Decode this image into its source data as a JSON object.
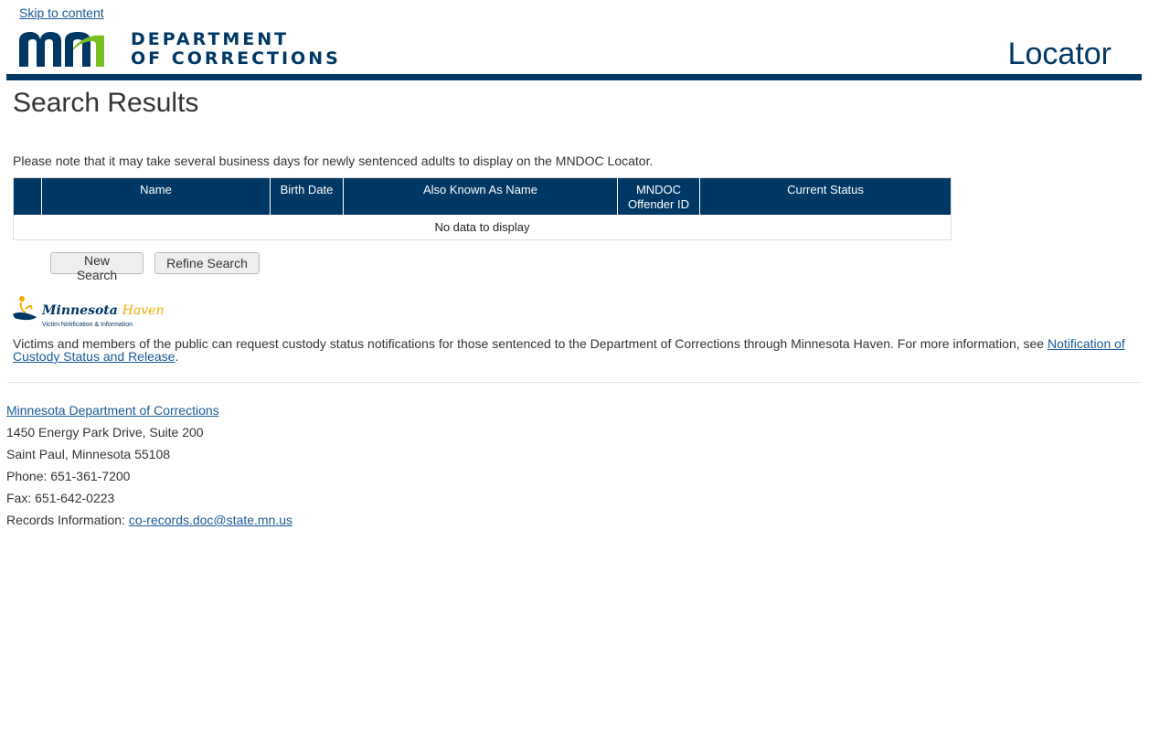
{
  "skip_link": "Skip to content",
  "header": {
    "logo_line1": "DEPARTMENT",
    "logo_line2": "OF CORRECTIONS",
    "title": "Locator"
  },
  "page_title": "Search Results",
  "notice": "Please note that it may take several business days for newly sentenced adults to display on the MNDOC Locator.",
  "table": {
    "columns": [
      "",
      "Name",
      "Birth Date",
      "Also Known As Name",
      "MNDOC Offender ID",
      "Current Status"
    ],
    "empty_message": "No data to display"
  },
  "buttons": {
    "new_search": "New Search",
    "refine_search": "Refine Search"
  },
  "haven": {
    "logo_word1": "Minnesota",
    "logo_word2": "Haven",
    "logo_sub": "Victim Notification & Information",
    "info_text": "Victims and members of the public can request custody status notifications for those sentenced to the Department of Corrections through Minnesota Haven. For more information, see ",
    "info_link": "Notification of Custody Status and Release",
    "info_end": "."
  },
  "footer": {
    "org_link": "Minnesota Department of Corrections",
    "address1": "1450 Energy Park Drive, Suite 200",
    "address2": "Saint Paul, Minnesota 55108",
    "phone": "Phone: 651-361-7200",
    "fax": "Fax: 651-642-0223",
    "records_label": "Records Information: ",
    "records_email": "co-records.doc@state.mn.us"
  },
  "colors": {
    "brand_navy": "#003865",
    "brand_green": "#78be21",
    "haven_gold": "#f2a900",
    "link": "#1a5a96"
  }
}
